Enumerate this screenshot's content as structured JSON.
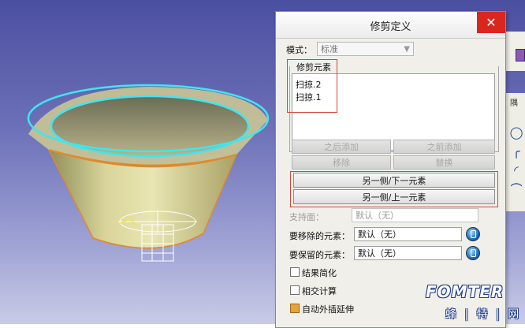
{
  "dialog": {
    "title": "修剪定义",
    "close_glyph": "✕",
    "mode_label": "模式：",
    "mode_value": "标准",
    "group_label": "修剪元素",
    "elements": [
      "扫掠.2",
      "扫掠.1"
    ],
    "buttons_disabled": [
      "之后添加",
      "之前添加",
      "移除",
      "替换"
    ],
    "buttons_active": [
      "另一侧/下一元素",
      "另一侧/上一元素"
    ],
    "support_label": "支持面：",
    "support_value": "默认（无）",
    "remove_label": "要移除的元素：",
    "remove_value": "默认（无）",
    "keep_label": "要保留的元素：",
    "keep_value": "默认（无）",
    "checkboxes": [
      {
        "label": "结果简化",
        "checked": false
      },
      {
        "label": "相交计算",
        "checked": false
      },
      {
        "label": "自动外插延伸",
        "checked": true
      }
    ]
  },
  "side_toolbar": {
    "header": "隅",
    "icons": [
      "circle-icon",
      "corner-icon",
      "arc-icon",
      "curve-icon"
    ]
  },
  "watermark": {
    "logo": "FOMTER",
    "sub": "蜂 | 特 | 网"
  },
  "colors": {
    "viewport_top": "#4b4fa0",
    "viewport_bottom": "#c9cbe6",
    "edge_cyan": "#3ee6f0",
    "surface_olive": "#d9d48f",
    "highlight_red": "#d7443e",
    "checked_orange": "#e7a23d"
  }
}
